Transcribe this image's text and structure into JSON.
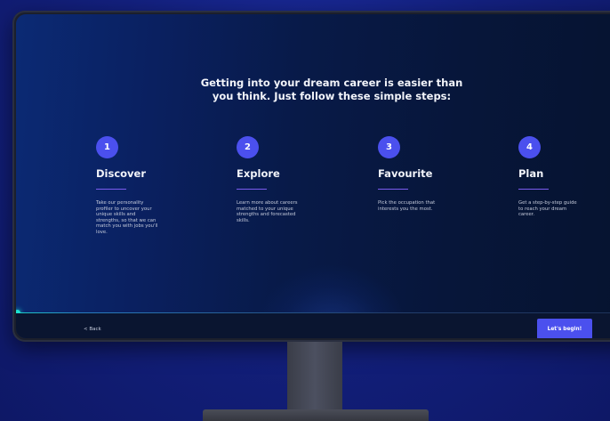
{
  "headline": {
    "line1": "Getting into your dream career is easier than",
    "line2": "you think. Just follow these simple steps:"
  },
  "steps": [
    {
      "number": "1",
      "title": "Discover",
      "description": "Take our personality profiler to uncover your unique skills and strengths, so that we can match you with jobs you'll love."
    },
    {
      "number": "2",
      "title": "Explore",
      "description": "Learn more about careers matched to your unique strengths and forecasted skills."
    },
    {
      "number": "3",
      "title": "Favourite",
      "description": "Pick the occupation that interests you the most."
    },
    {
      "number": "4",
      "title": "Plan",
      "description": "Get a step-by-step guide to reach your dream career."
    }
  ],
  "footer": {
    "back_label": "< Back",
    "begin_label": "Let's begin!"
  },
  "colors": {
    "accent": "#4b50ee",
    "underline": "#7b5cf0",
    "background": "#13207e",
    "screen": "#07163a",
    "progress_glow": "#1de0d0"
  }
}
